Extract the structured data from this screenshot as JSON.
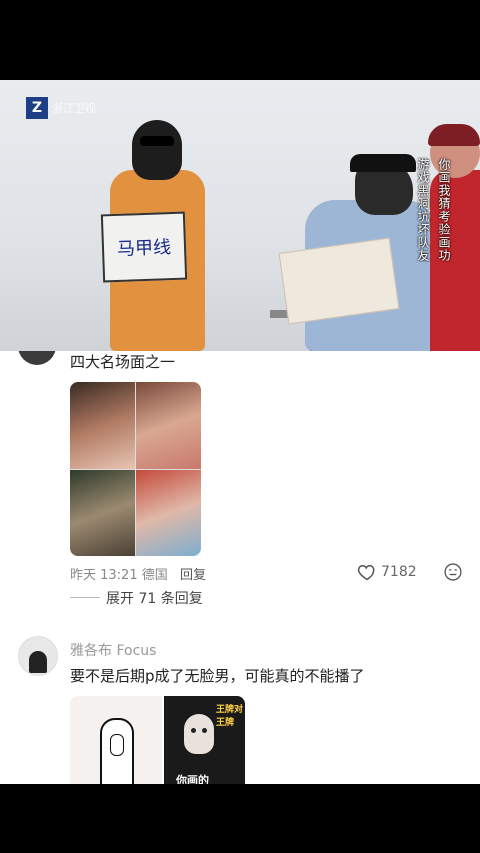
{
  "video": {
    "channel_logo_letter": "Z",
    "channel_logo_text": "浙江卫视",
    "sign_text": "马甲线",
    "subtitle_columns": [
      "你画我猜考验画功",
      "游戏黑洞坑坏队友"
    ]
  },
  "comment1": {
    "text": "四大名场面之一",
    "time_location": "昨天 13:21 德国",
    "reply_label": "回复",
    "likes": "7182",
    "expand_label": "展开 71 条回复"
  },
  "comment2": {
    "username": "雅各布 Focus",
    "text": "要不是后期p成了无脸男，可能真的不能播了",
    "image_caption": "你画的",
    "image_badge": "王牌对王牌"
  },
  "colors": {
    "link_gray": "#888888",
    "accent_orange": "#e2923f"
  }
}
